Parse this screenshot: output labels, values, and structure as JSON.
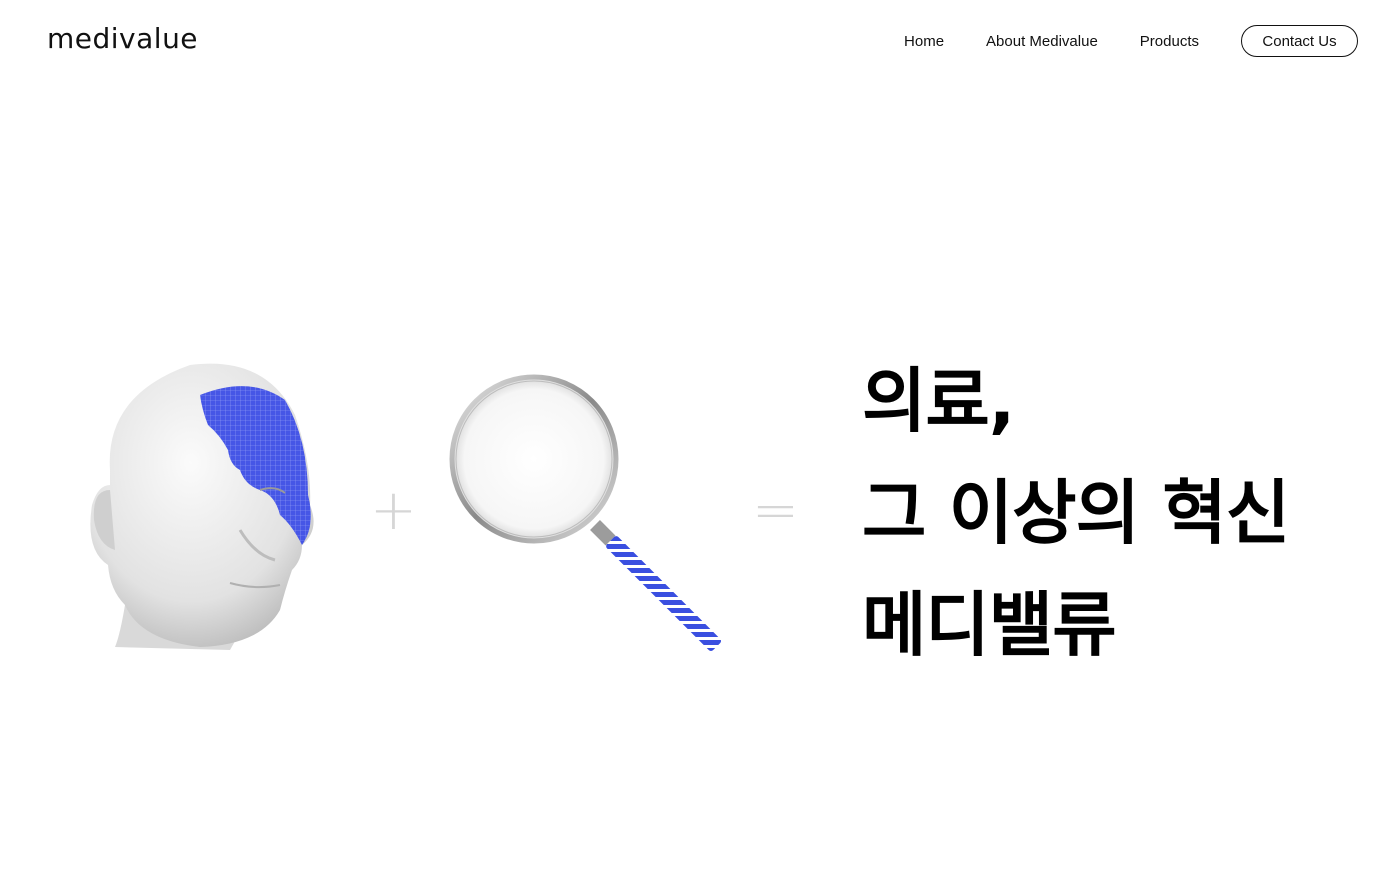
{
  "header": {
    "logo_text": "medivalue",
    "nav": {
      "home": "Home",
      "about": "About Medivalue",
      "products": "Products",
      "contact": "Contact Us"
    }
  },
  "hero": {
    "plus_symbol": "+",
    "equals_symbol": "=",
    "headline": {
      "line1": "의료,",
      "line2": "그 이상의 혁신",
      "line3": "메디밸류"
    },
    "icons": [
      "head-mesh-icon",
      "magnifier-icon"
    ],
    "colors": {
      "accent_blue": "#3a4fe0",
      "operator_gray": "#d6d6d6"
    }
  }
}
